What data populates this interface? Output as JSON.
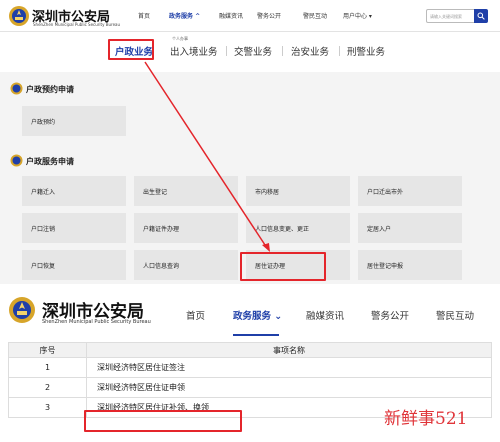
{
  "top_site": {
    "name": "深圳市公安局",
    "name_en": "ShenZhen Municipal Public Security Bureau",
    "nav": [
      "首页",
      "政务服务 ^",
      "融媒资讯",
      "警务公开",
      "警民互动",
      "用户中心 ▾"
    ],
    "search_placeholder": "请输入关键词搜索",
    "sub_hint": "个人办事",
    "sub_nav": [
      "户政业务",
      "出入境业务",
      "交警业务",
      "治安业务",
      "刑警业务"
    ]
  },
  "sections": [
    {
      "title": "户政预约申请",
      "items": [
        "户政预约"
      ]
    },
    {
      "title": "户政服务申请",
      "items": [
        "户籍迁入",
        "出生登记",
        "市内移居",
        "户口迁出市外",
        "户口注销",
        "户籍证件办理",
        "人口信息变更、更正",
        "定居入户",
        "户口恢复",
        "人口信息查询",
        "居住证办理",
        "居住登记申报"
      ]
    }
  ],
  "bottom_site": {
    "name": "深圳市公安局",
    "name_en": "ShenZhen Municipal Public Security Bureau",
    "nav": [
      "首页",
      "政务服务 ⌄",
      "融媒资讯",
      "警务公开",
      "警民互动"
    ]
  },
  "table": {
    "headers": [
      "序号",
      "事项名称"
    ],
    "rows": [
      {
        "num": "1",
        "name": "深圳经济特区居住证签注"
      },
      {
        "num": "2",
        "name": "深圳经济特区居住证申领"
      },
      {
        "num": "3",
        "name": "深圳经济特区居住证补领、换领"
      }
    ]
  },
  "watermark": "新鲜事521",
  "colors": {
    "accent": "#1f3fa8",
    "highlight": "#e4252b",
    "tile": "#e6e6e6"
  }
}
